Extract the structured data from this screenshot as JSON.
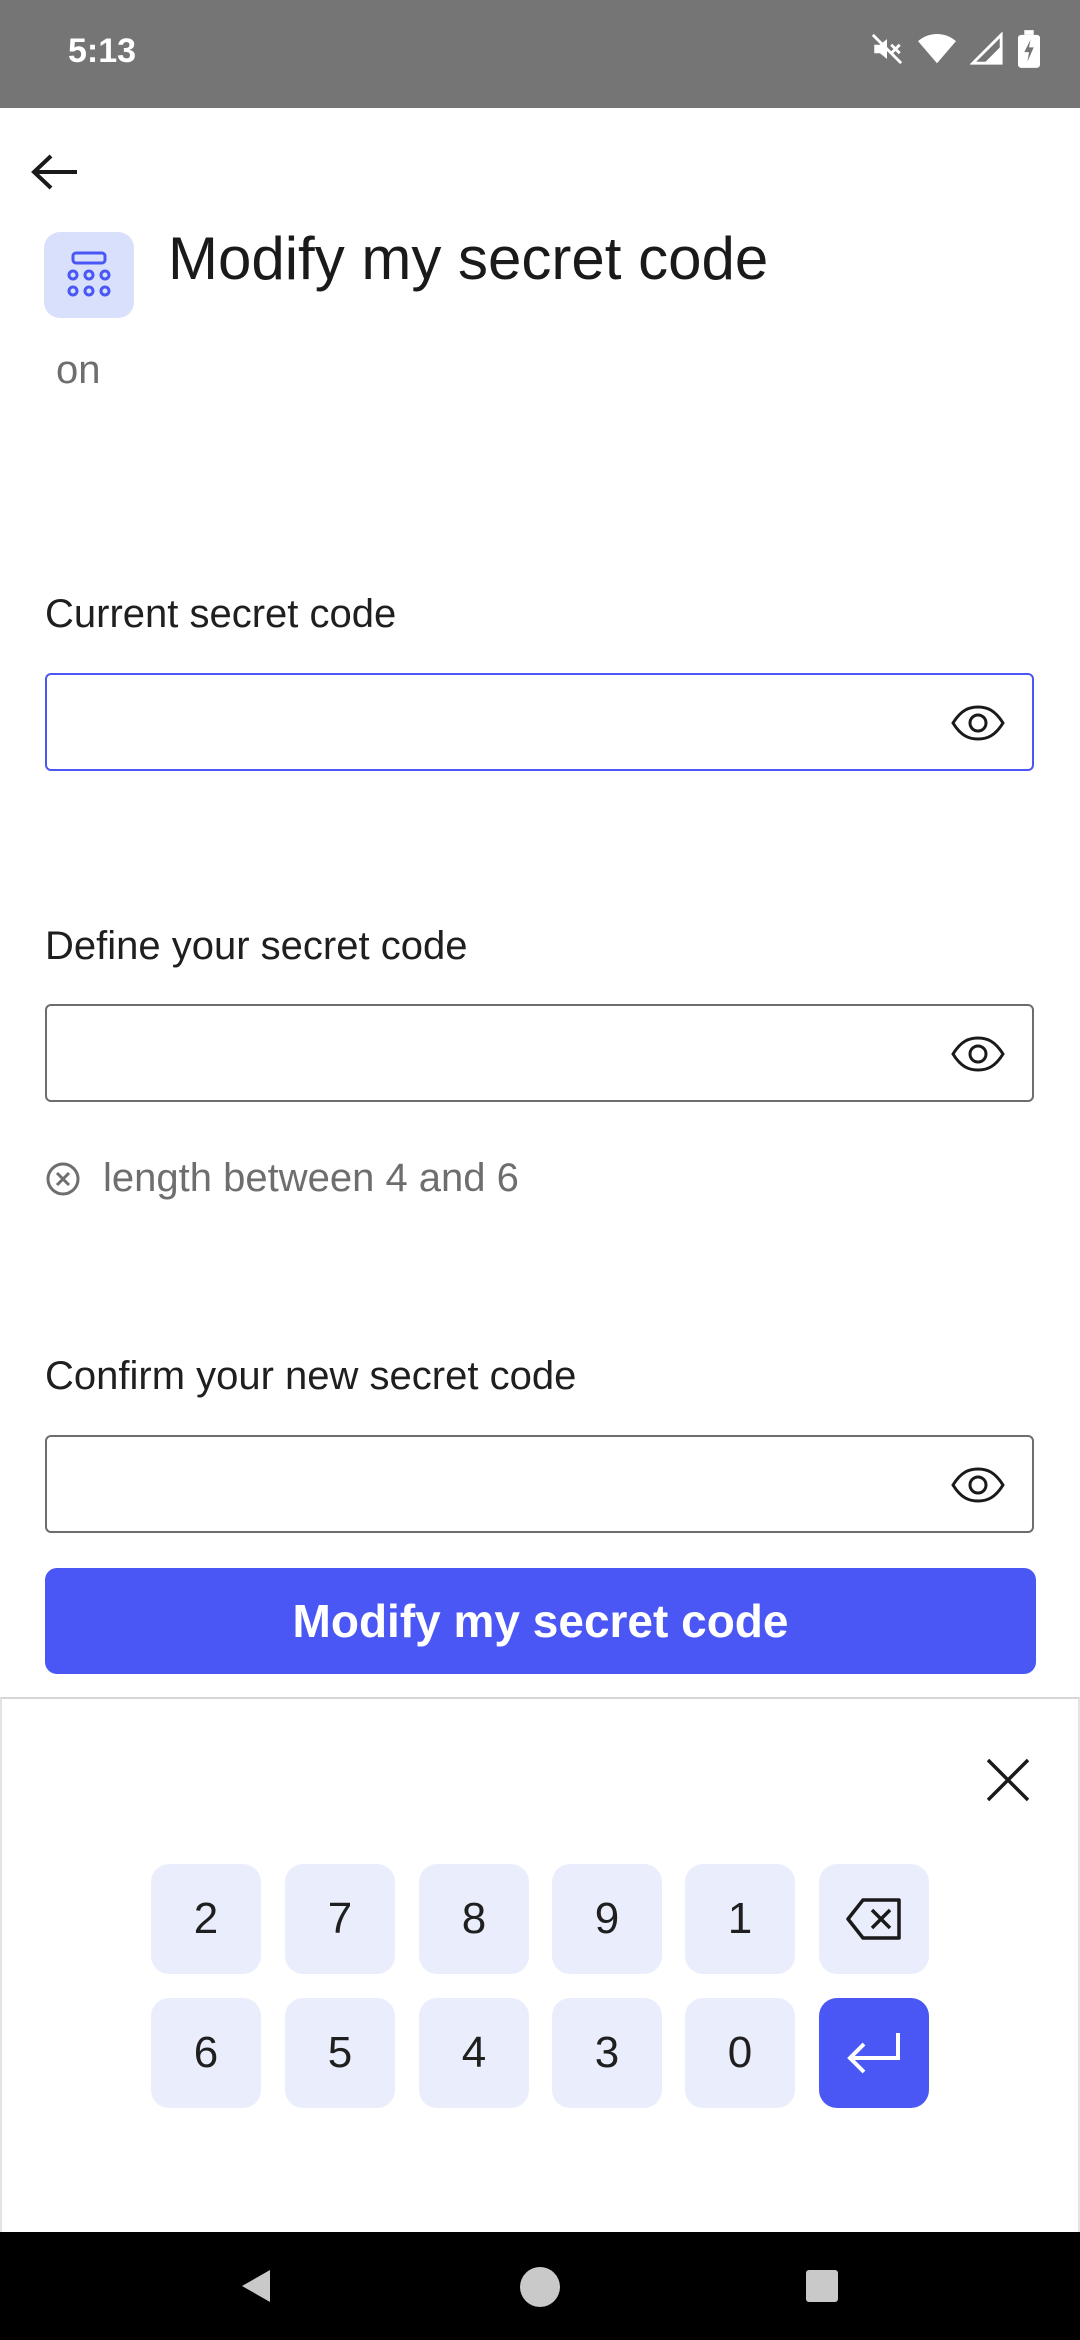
{
  "status_bar": {
    "time": "5:13"
  },
  "header": {
    "title": "Modify my secret code",
    "subtitle": "on"
  },
  "fields": {
    "current": {
      "label": "Current secret code",
      "value": ""
    },
    "define": {
      "label": "Define your secret code",
      "value": ""
    },
    "confirm": {
      "label": "Confirm your new secret code",
      "value": ""
    }
  },
  "hint": {
    "text": "length between 4 and 6"
  },
  "submit": {
    "label": "Modify my secret code"
  },
  "keypad": {
    "row1": [
      "2",
      "7",
      "8",
      "9",
      "1"
    ],
    "row2": [
      "6",
      "5",
      "4",
      "3",
      "0"
    ]
  },
  "colors": {
    "accent": "#4a57f5",
    "key_bg": "#eaedfb",
    "icon_bg": "#d9e0fb"
  }
}
